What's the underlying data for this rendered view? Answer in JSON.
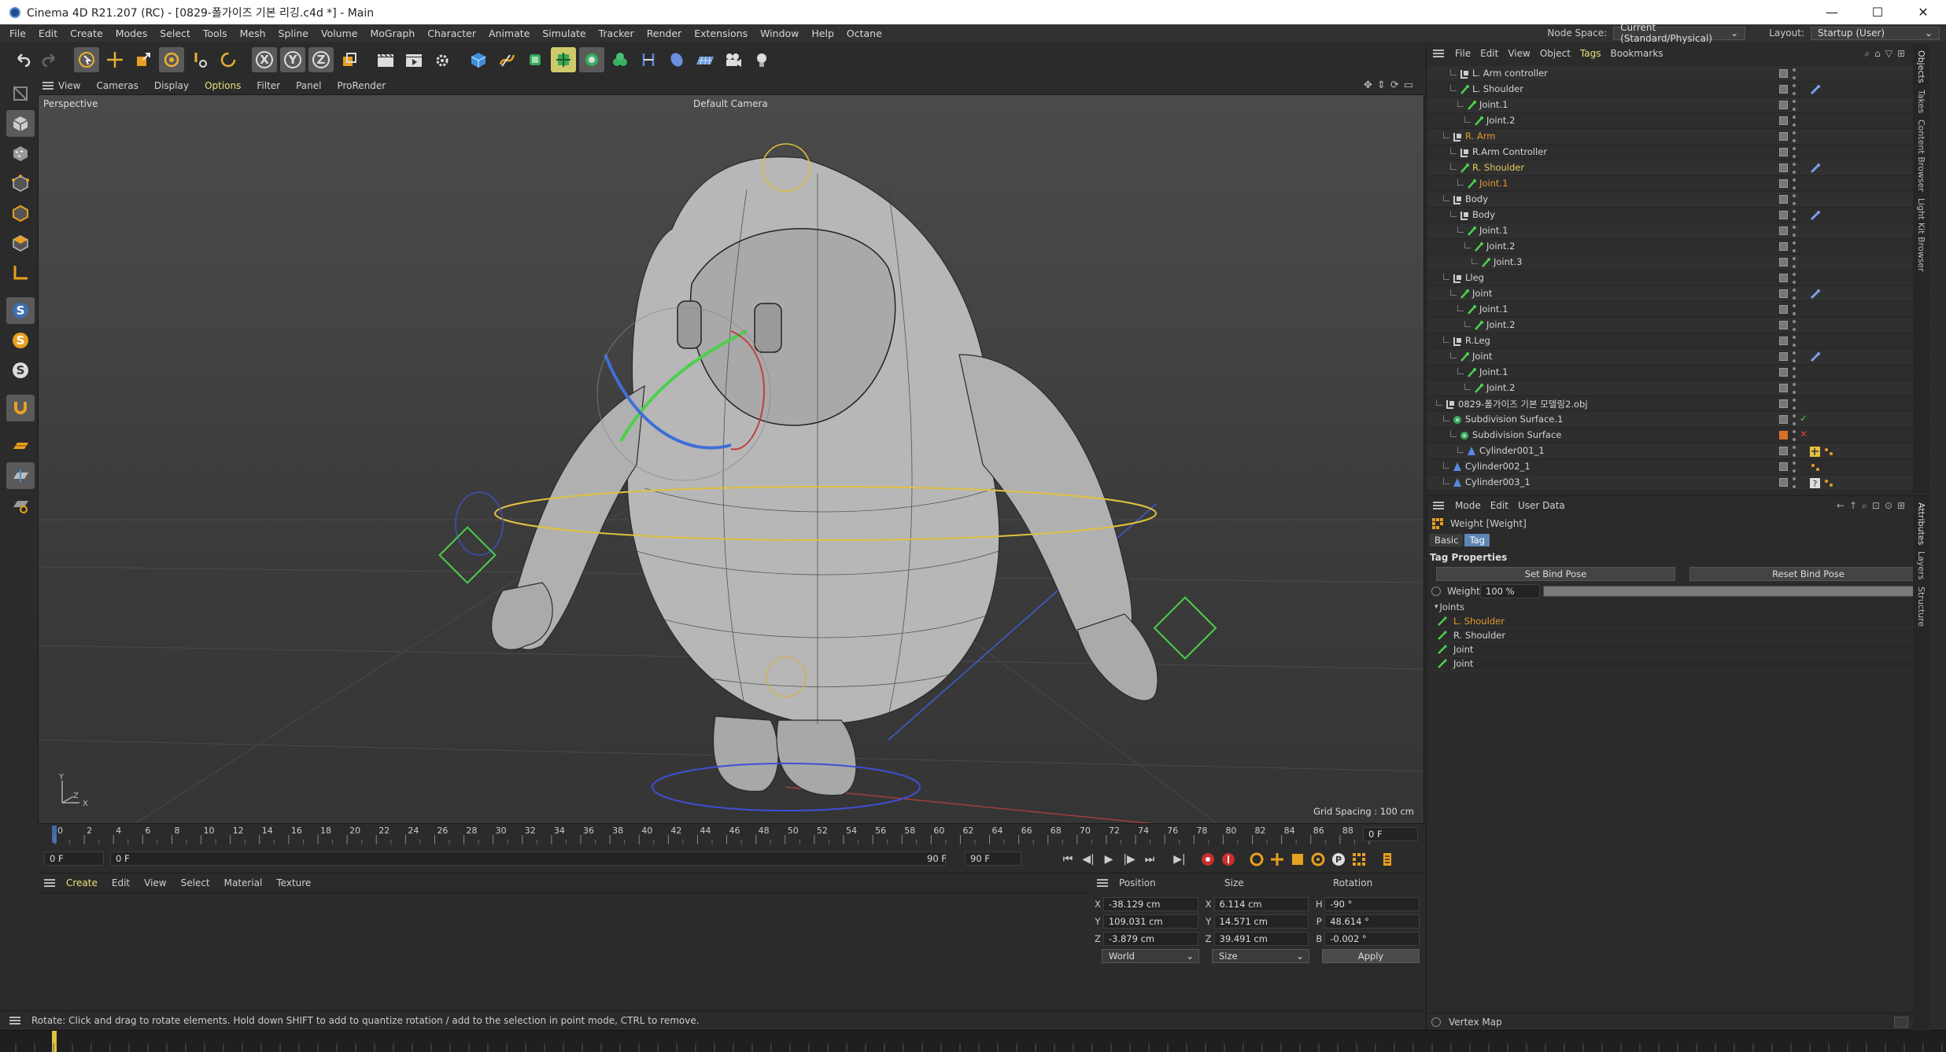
{
  "window": {
    "title": "Cinema 4D R21.207 (RC) - [0829-폴가이즈 기본 리깅.c4d *] - Main",
    "controls": [
      "—",
      "☐",
      "✕"
    ]
  },
  "menu": {
    "items": [
      "File",
      "Edit",
      "Create",
      "Modes",
      "Select",
      "Tools",
      "Mesh",
      "Spline",
      "Volume",
      "MoGraph",
      "Character",
      "Animate",
      "Simulate",
      "Tracker",
      "Render",
      "Extensions",
      "Window",
      "Help",
      "Octane"
    ],
    "node_space_label": "Node Space:",
    "node_space_value": "Current (Standard/Physical)",
    "layout_label": "Layout:",
    "layout_value": "Startup (User)"
  },
  "toolbar": {
    "axis_x": "X",
    "axis_y": "Y",
    "axis_z": "Z"
  },
  "viewport": {
    "menu": [
      "View",
      "Cameras",
      "Display",
      "Options",
      "Filter",
      "Panel",
      "ProRender"
    ],
    "active_menu": "Options",
    "view_name": "Perspective",
    "camera_name": "Default Camera",
    "grid_spacing": "Grid Spacing : 100 cm",
    "axis_y": "Y",
    "axis_z": "Z",
    "axis_x": "X"
  },
  "timeline": {
    "ticks": [
      "0",
      "2",
      "4",
      "6",
      "8",
      "10",
      "12",
      "14",
      "16",
      "18",
      "20",
      "22",
      "24",
      "26",
      "28",
      "30",
      "32",
      "34",
      "36",
      "38",
      "40",
      "42",
      "44",
      "46",
      "48",
      "50",
      "52",
      "54",
      "56",
      "58",
      "60",
      "62",
      "64",
      "66",
      "68",
      "70",
      "72",
      "74",
      "76",
      "78",
      "80",
      "82",
      "84",
      "86",
      "88",
      "90"
    ],
    "current_frame": "0 F",
    "start_field": "0 F",
    "start_field2": "0 F",
    "end_field": "90 F",
    "end_field2": "90 F"
  },
  "material_manager": {
    "menu": [
      "Create",
      "Edit",
      "View",
      "Select",
      "Material",
      "Texture"
    ],
    "active_menu": "Create"
  },
  "coordinates": {
    "headers": [
      "Position",
      "Size",
      "Rotation"
    ],
    "rows": [
      {
        "axis": "X",
        "pos": "-38.129 cm",
        "size_axis": "X",
        "size": "6.114 cm",
        "rot_axis": "H",
        "rot": "-90 °"
      },
      {
        "axis": "Y",
        "pos": "109.031 cm",
        "size_axis": "Y",
        "size": "14.571 cm",
        "rot_axis": "P",
        "rot": "48.614 °"
      },
      {
        "axis": "Z",
        "pos": "-3.879 cm",
        "size_axis": "Z",
        "size": "39.491 cm",
        "rot_axis": "B",
        "rot": "-0.002 °"
      }
    ],
    "mode_select": "World",
    "size_select": "Size",
    "apply_label": "Apply"
  },
  "status": {
    "text": "Rotate: Click and drag to rotate elements. Hold down SHIFT to add to quantize rotation / add to the selection in point mode, CTRL to remove."
  },
  "object_manager": {
    "menu": [
      "File",
      "Edit",
      "View",
      "Object",
      "Tags",
      "Bookmarks"
    ],
    "active_menu": "Tags",
    "side_tabs": [
      "Objects",
      "Takes",
      "Content Browser",
      "Light Kit Browser"
    ],
    "rows": [
      {
        "name": "L. Arm controller",
        "indent": 2,
        "color": "normal",
        "icon": "null"
      },
      {
        "name": "L. Shoulder",
        "indent": 2,
        "color": "normal",
        "icon": "joint",
        "tag": "weight"
      },
      {
        "name": "Joint.1",
        "indent": 3,
        "color": "normal",
        "icon": "joint"
      },
      {
        "name": "Joint.2",
        "indent": 4,
        "color": "normal",
        "icon": "joint"
      },
      {
        "name": "R. Arm",
        "indent": 1,
        "color": "orange",
        "icon": "null"
      },
      {
        "name": "R.Arm Controller",
        "indent": 2,
        "color": "normal",
        "icon": "null"
      },
      {
        "name": "R. Shoulder",
        "indent": 2,
        "color": "yellow",
        "icon": "joint",
        "tag": "weight"
      },
      {
        "name": "Joint.1",
        "indent": 3,
        "color": "orange",
        "icon": "joint"
      },
      {
        "name": "Body",
        "indent": 1,
        "color": "normal",
        "icon": "null"
      },
      {
        "name": "Body",
        "indent": 2,
        "color": "normal",
        "icon": "null",
        "tag": "weight"
      },
      {
        "name": "Joint.1",
        "indent": 3,
        "color": "normal",
        "icon": "joint"
      },
      {
        "name": "Joint.2",
        "indent": 4,
        "color": "normal",
        "icon": "joint"
      },
      {
        "name": "Joint.3",
        "indent": 5,
        "color": "normal",
        "icon": "joint"
      },
      {
        "name": "Lleg",
        "indent": 1,
        "color": "normal",
        "icon": "null"
      },
      {
        "name": "Joint",
        "indent": 2,
        "color": "normal",
        "icon": "joint",
        "tag": "weight"
      },
      {
        "name": "Joint.1",
        "indent": 3,
        "color": "normal",
        "icon": "joint"
      },
      {
        "name": "Joint.2",
        "indent": 4,
        "color": "normal",
        "icon": "joint"
      },
      {
        "name": "R.Leg",
        "indent": 1,
        "color": "normal",
        "icon": "null"
      },
      {
        "name": "Joint",
        "indent": 2,
        "color": "normal",
        "icon": "joint",
        "tag": "weight"
      },
      {
        "name": "Joint.1",
        "indent": 3,
        "color": "normal",
        "icon": "joint"
      },
      {
        "name": "Joint.2",
        "indent": 4,
        "color": "normal",
        "icon": "joint"
      },
      {
        "name": "0829-폴가이즈 기본 모델링2.obj",
        "indent": 0,
        "color": "normal",
        "icon": "null"
      },
      {
        "name": "Subdivision Surface.1",
        "indent": 1,
        "color": "normal",
        "icon": "subdiv",
        "check": "check"
      },
      {
        "name": "Subdivision Surface",
        "indent": 2,
        "color": "normal",
        "icon": "subdiv",
        "check": "cross"
      },
      {
        "name": "Cylinder001_1",
        "indent": 3,
        "color": "normal",
        "icon": "poly",
        "tag": "skin"
      },
      {
        "name": "Cylinder002_1",
        "indent": 1,
        "color": "normal",
        "icon": "poly",
        "tag": "dots"
      },
      {
        "name": "Cylinder003_1",
        "indent": 1,
        "color": "normal",
        "icon": "poly",
        "tag": "question"
      }
    ]
  },
  "attribute_manager": {
    "menu": [
      "Mode",
      "Edit",
      "User Data"
    ],
    "side_tabs": [
      "Attributes",
      "Layers",
      "Structure"
    ],
    "object_title": "Weight [Weight]",
    "tabs": [
      "Basic",
      "Tag"
    ],
    "active_tab": "Tag",
    "section_title": "Tag Properties",
    "set_bind_pose": "Set Bind Pose",
    "reset_bind_pose": "Reset Bind Pose",
    "weight_label": "Weight",
    "weight_value": "100 %",
    "weight_fraction": 1.0,
    "joints_label": "Joints",
    "joints": [
      {
        "name": "L. Shoulder",
        "color": "orange"
      },
      {
        "name": "R. Shoulder",
        "color": "normal"
      },
      {
        "name": "Joint",
        "color": "normal"
      },
      {
        "name": "Joint",
        "color": "normal"
      }
    ],
    "vertex_map_label": "Vertex Map"
  },
  "colors": {
    "accent_yellow": "#e8e07a",
    "orange": "#e39a2e",
    "selected_tab": "#5d86b4",
    "joint_green": "#4bd04b"
  }
}
